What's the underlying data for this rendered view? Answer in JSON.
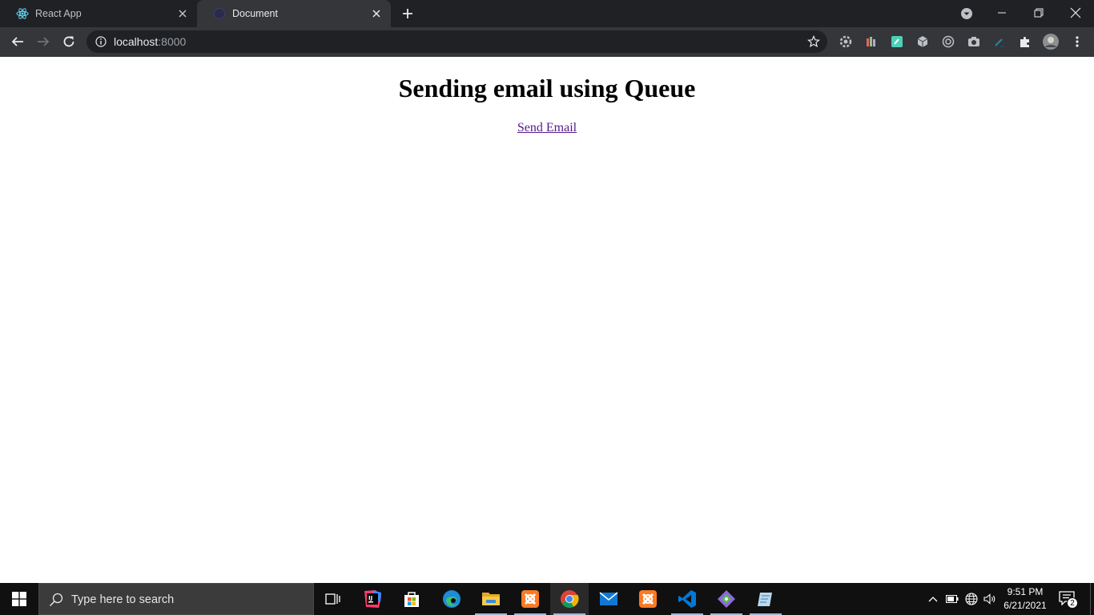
{
  "browser": {
    "tabs": [
      {
        "title": "React App",
        "favicon": "react-icon",
        "active": false
      },
      {
        "title": "Document",
        "favicon": "globe-icon",
        "active": true
      }
    ],
    "address": {
      "host": "localhost",
      "port": ":8000"
    },
    "extensions": [
      "extension-gear-icon",
      "extension-color-icon",
      "extension-clip-icon",
      "extension-cube-icon",
      "extension-target-icon",
      "extension-camera-icon",
      "extension-edit-icon",
      "extensions-puzzle-icon",
      "profile-avatar"
    ]
  },
  "page": {
    "heading": "Sending email using Queue",
    "link_label": "Send Email"
  },
  "taskbar": {
    "search_placeholder": "Type here to search",
    "apps": [
      "task-view-icon",
      "intellij-icon",
      "store-icon",
      "edge-icon",
      "file-explorer-icon",
      "xampp-icon",
      "chrome-icon",
      "mail-icon",
      "xampp-icon",
      "vscode-icon",
      "git-icon",
      "notepad-icon"
    ],
    "clock_time": "9:51 PM",
    "clock_date": "6/21/2021",
    "notification_count": "2"
  },
  "colors": {
    "tabstrip_bg": "#202124",
    "toolbar_bg": "#35363a",
    "link_visited": "#551a8b",
    "taskbar_bg": "#101010"
  }
}
